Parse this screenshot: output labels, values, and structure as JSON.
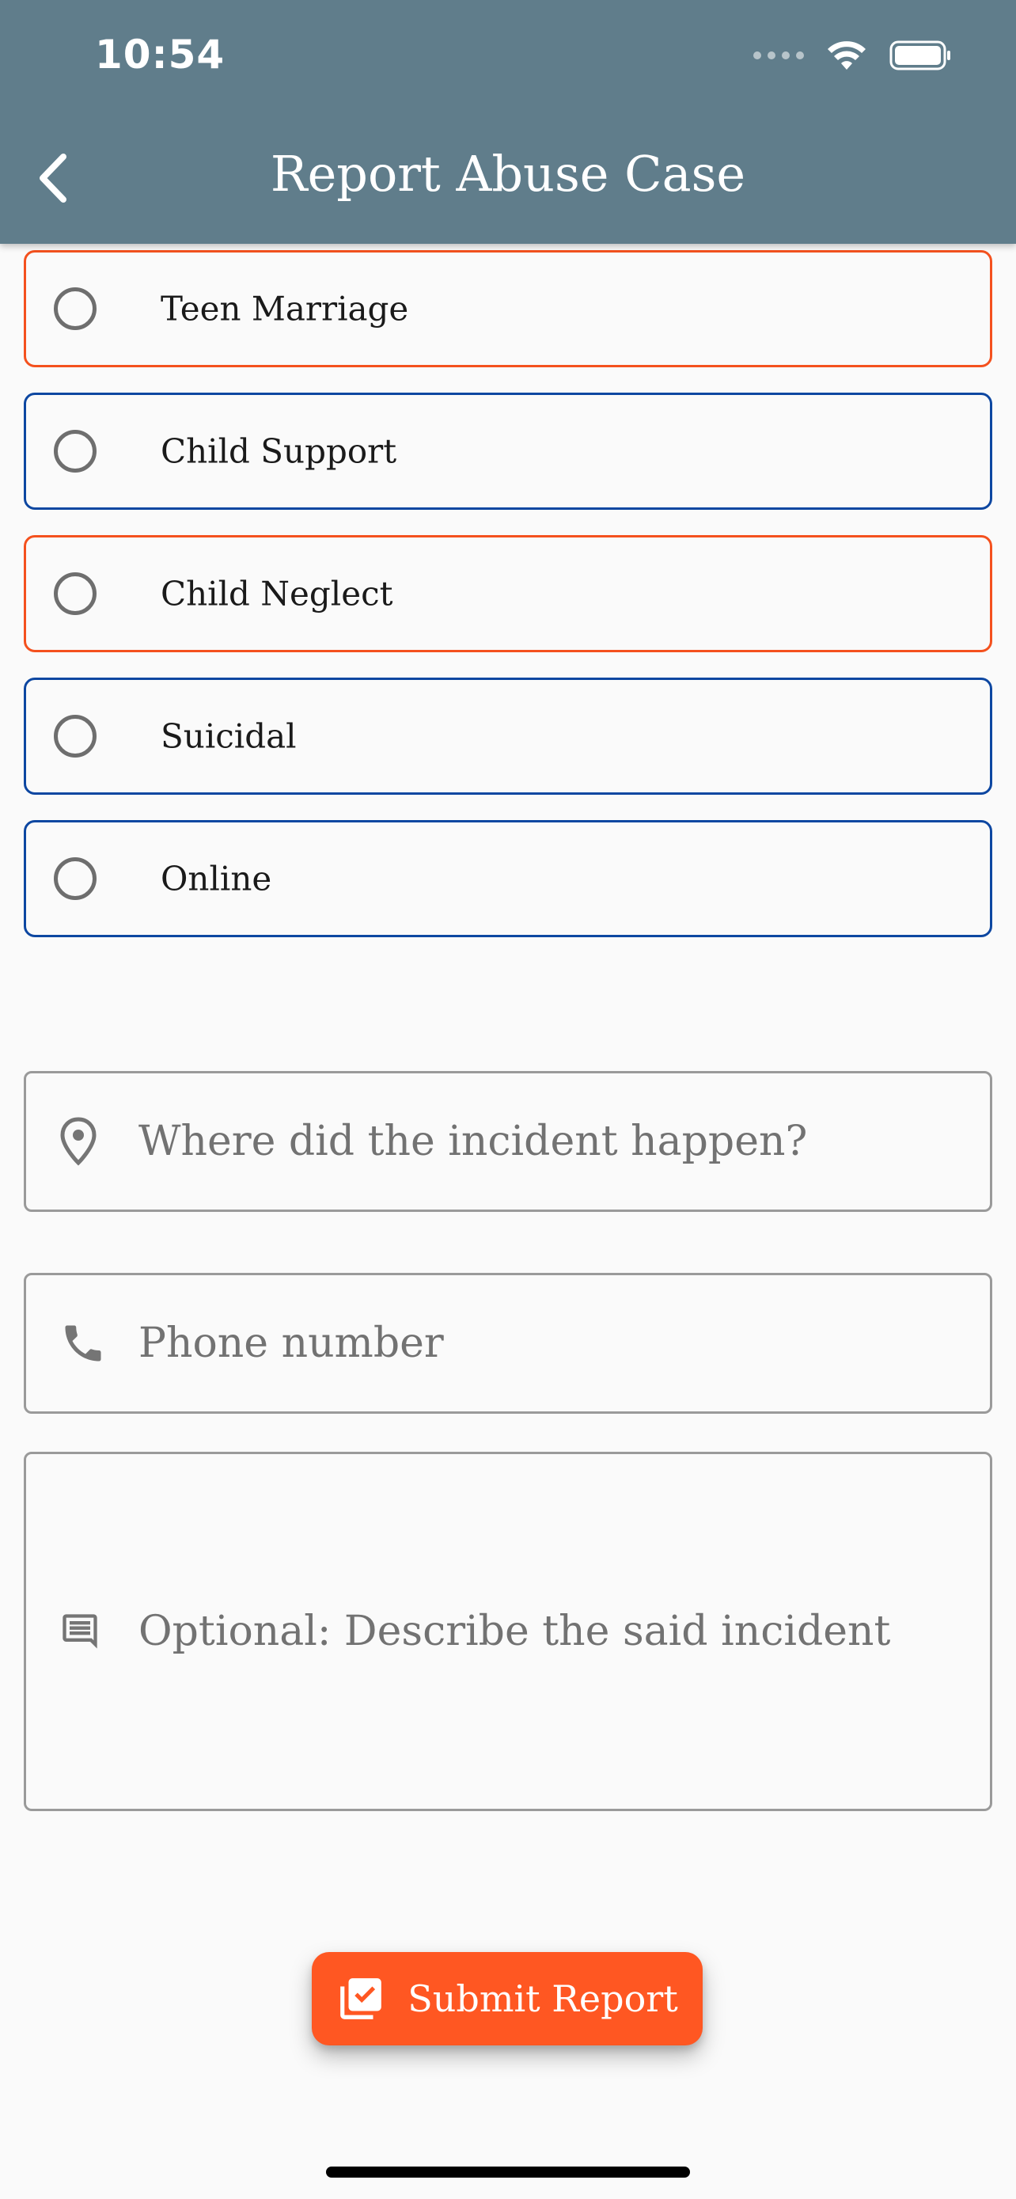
{
  "status_bar": {
    "time": "10:54"
  },
  "header": {
    "title": "Report Abuse Case",
    "back_icon": "chevron-left-icon"
  },
  "options": [
    {
      "label": "Teen Marriage",
      "border_color": "#f4511e"
    },
    {
      "label": "Child Support",
      "border_color": "#0d47a1"
    },
    {
      "label": "Child Neglect",
      "border_color": "#f4511e"
    },
    {
      "label": "Suicidal",
      "border_color": "#0d47a1"
    },
    {
      "label": "Online",
      "border_color": "#0d47a1"
    }
  ],
  "form": {
    "location": {
      "placeholder": "Where did the incident happen?",
      "value": "",
      "icon": "location-pin-icon"
    },
    "phone": {
      "placeholder": "Phone number",
      "value": "",
      "icon": "phone-icon"
    },
    "description": {
      "placeholder": "Optional: Describe the said incident",
      "value": "",
      "icon": "comment-icon"
    }
  },
  "submit": {
    "label": "Submit Report",
    "icon": "checklist-icon",
    "color": "#ff5722"
  },
  "colors": {
    "app_bar": "#607d8b",
    "orange_accent": "#f4511e",
    "blue_accent": "#0d47a1"
  }
}
